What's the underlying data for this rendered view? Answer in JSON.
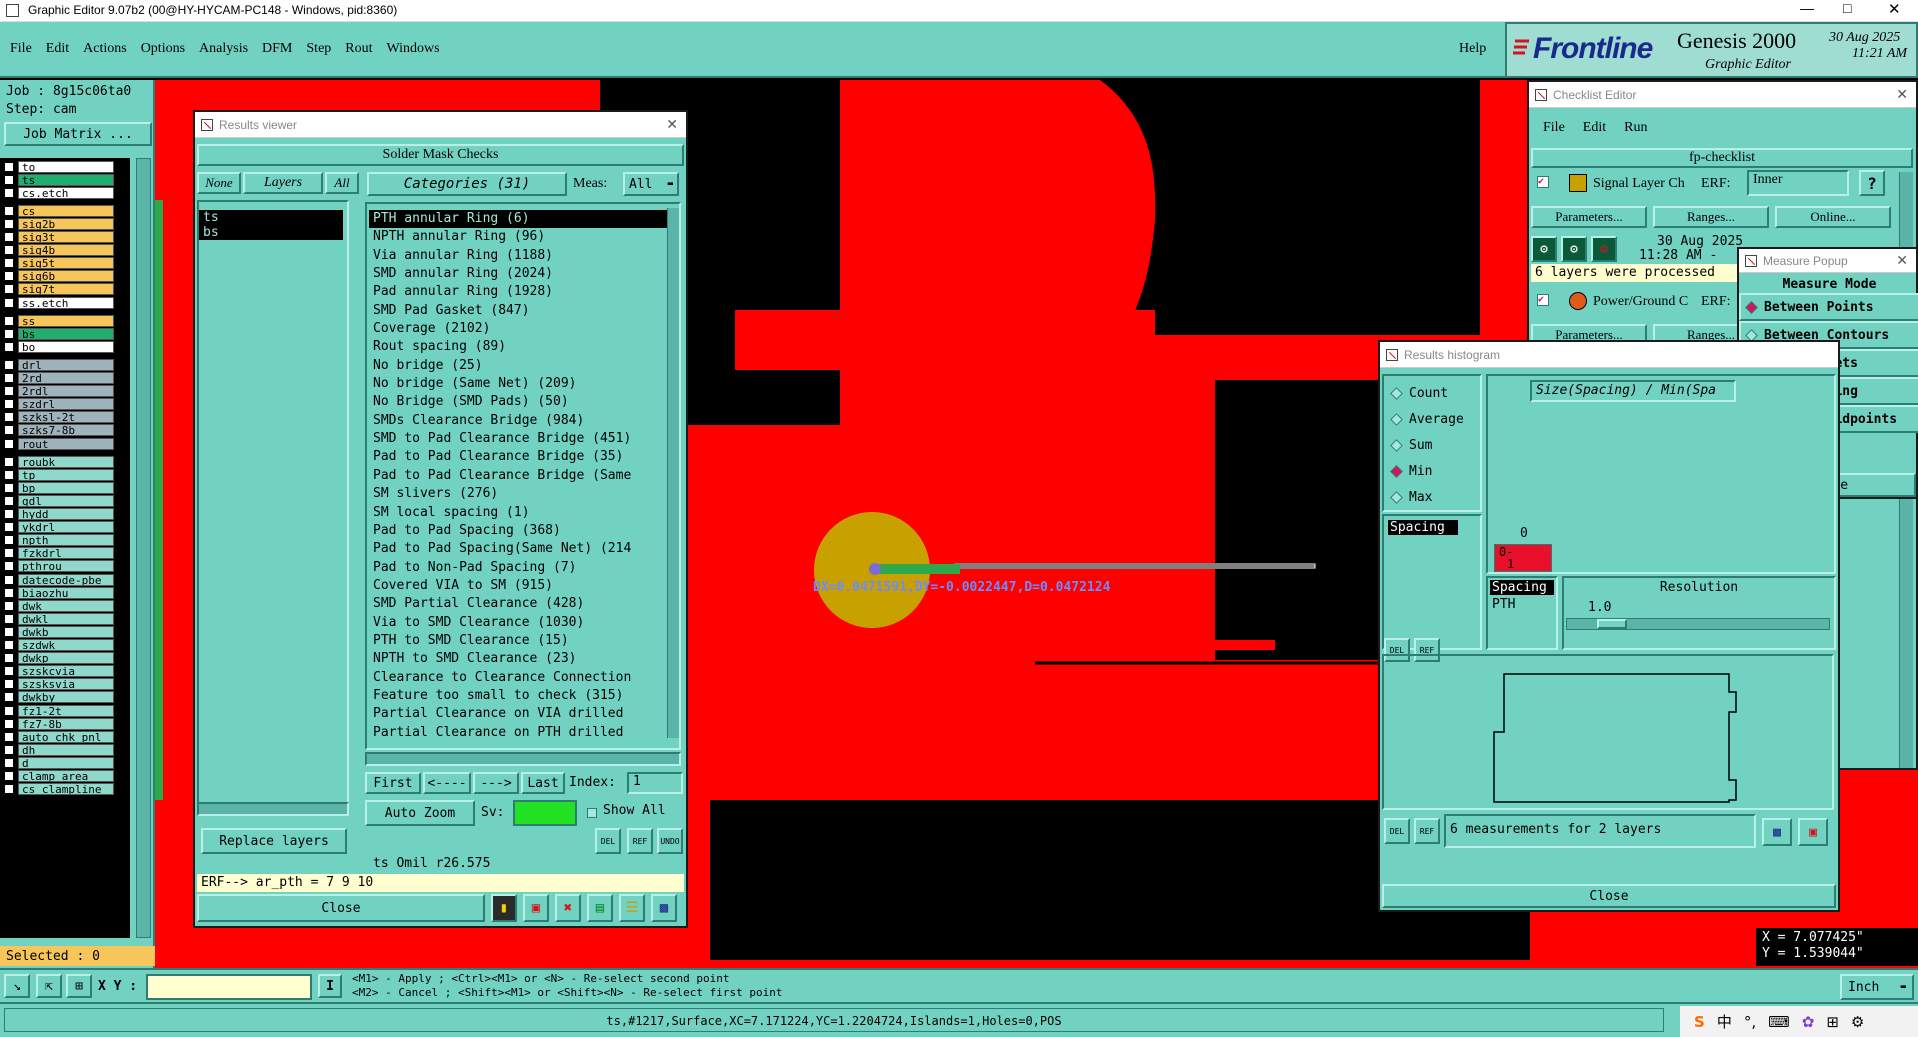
{
  "app_title": "Graphic Editor 9.07b2 (00@HY-HYCAM-PC148 - Windows, pid:8360)",
  "menu": [
    "File",
    "Edit",
    "Actions",
    "Options",
    "Analysis",
    "DFM",
    "Step",
    "Rout",
    "Windows"
  ],
  "help": "Help",
  "brand": {
    "logo": "Frontline",
    "product": "Genesis 2000",
    "sub": "Graphic Editor",
    "date": "30 Aug 2025",
    "time": "11:21 AM"
  },
  "job": {
    "job_label": "Job  : 8g15c06ta0",
    "step_label": "Step: cam",
    "matrix_button": "Job Matrix ..."
  },
  "layers": [
    {
      "name": "to",
      "bg": "#ffffff"
    },
    {
      "name": "ts",
      "bg": "#1fae6e"
    },
    {
      "name": "cs.etch",
      "bg": "#ffffff"
    },
    {
      "name": "cs",
      "bg": "#f7c65a"
    },
    {
      "name": "sig2b",
      "bg": "#f7c65a"
    },
    {
      "name": "sig3t",
      "bg": "#f7c65a"
    },
    {
      "name": "sig4b",
      "bg": "#f7c65a"
    },
    {
      "name": "sig5t",
      "bg": "#f7c65a"
    },
    {
      "name": "sig6b",
      "bg": "#f7c65a"
    },
    {
      "name": "sig7t",
      "bg": "#f7c65a"
    },
    {
      "name": "ss.etch",
      "bg": "#ffffff"
    },
    {
      "name": "ss",
      "bg": "#f7c65a"
    },
    {
      "name": "bs",
      "bg": "#1fae6e"
    },
    {
      "name": "bo",
      "bg": "#ffffff"
    },
    {
      "name": "drl",
      "bg": "#9fb3bd"
    },
    {
      "name": "2rd",
      "bg": "#9fb3bd"
    },
    {
      "name": "2rdl",
      "bg": "#9fb3bd"
    },
    {
      "name": "szdrl",
      "bg": "#9fb3bd"
    },
    {
      "name": "szksl-2t",
      "bg": "#9fb3bd"
    },
    {
      "name": "szks7-8b",
      "bg": "#9fb3bd"
    },
    {
      "name": "rout",
      "bg": "#9fb3bd"
    },
    {
      "name": "roubk",
      "bg": "#8fd8cc"
    },
    {
      "name": "tp",
      "bg": "#8fd8cc"
    },
    {
      "name": "bp",
      "bg": "#8fd8cc"
    },
    {
      "name": "gdl",
      "bg": "#8fd8cc"
    },
    {
      "name": "hydd",
      "bg": "#8fd8cc"
    },
    {
      "name": "ykdrl",
      "bg": "#8fd8cc"
    },
    {
      "name": "npth",
      "bg": "#8fd8cc"
    },
    {
      "name": "fzkdrl",
      "bg": "#8fd8cc"
    },
    {
      "name": "pthrou",
      "bg": "#8fd8cc"
    },
    {
      "name": "datecode-pbe",
      "bg": "#8fd8cc"
    },
    {
      "name": "biaozhu",
      "bg": "#8fd8cc"
    },
    {
      "name": "dwk",
      "bg": "#8fd8cc"
    },
    {
      "name": "dwkl",
      "bg": "#8fd8cc"
    },
    {
      "name": "dwkb",
      "bg": "#8fd8cc"
    },
    {
      "name": "szdwk",
      "bg": "#8fd8cc"
    },
    {
      "name": "dwkp",
      "bg": "#8fd8cc"
    },
    {
      "name": "szskcvia",
      "bg": "#8fd8cc"
    },
    {
      "name": "szsksvia",
      "bg": "#8fd8cc"
    },
    {
      "name": "dwkby",
      "bg": "#8fd8cc"
    },
    {
      "name": "fz1-2t",
      "bg": "#8fd8cc"
    },
    {
      "name": "fz7-8b",
      "bg": "#8fd8cc"
    },
    {
      "name": "auto_chk_pnl",
      "bg": "#8fd8cc"
    },
    {
      "name": "dh",
      "bg": "#8fd8cc"
    },
    {
      "name": "d",
      "bg": "#8fd8cc"
    },
    {
      "name": "clamp_area",
      "bg": "#8fd8cc"
    },
    {
      "name": "cs_clampline",
      "bg": "#8fd8cc"
    }
  ],
  "selected_label": "Selected : 0",
  "results_viewer": {
    "title": "Results viewer",
    "header": "Solder Mask Checks",
    "none_btn": "None",
    "layers_btn": "Layers",
    "all_btn": "All",
    "categories_btn": "Categories (31)",
    "meas_label": "Meas:",
    "meas_value": "All",
    "layer_list": [
      "ts",
      "bs"
    ],
    "categories": [
      "PTH annular Ring (6)",
      "NPTH annular Ring (96)",
      "Via annular Ring (1188)",
      "SMD annular Ring (2024)",
      "Pad annular Ring (1928)",
      "SMD Pad Gasket (847)",
      "Coverage (2102)",
      "Rout spacing (89)",
      "No bridge (25)",
      "No bridge (Same Net) (209)",
      "No Bridge (SMD Pads) (50)",
      "SMDs Clearance Bridge (984)",
      "SMD to Pad Clearance Bridge (451)",
      "Pad to Pad Clearance Bridge (35)",
      "Pad to Pad Clearance Bridge (Same",
      "SM slivers (276)",
      "SM local spacing (1)",
      "Pad to Pad Spacing (368)",
      "Pad to Pad Spacing(Same Net) (214",
      "Pad to Non-Pad Spacing (7)",
      "Covered VIA to SM (915)",
      "SMD Partial Clearance (428)",
      "Via to SMD Clearance (1030)",
      "PTH to SMD Clearance (15)",
      "NPTH to SMD Clearance (23)",
      "Clearance to Clearance Connection",
      "Feature too small to check (315)",
      "Partial Clearance on VIA drilled",
      "Partial Clearance on PTH drilled"
    ],
    "first": "First",
    "prev": "<----",
    "next": "--->",
    "last": "Last",
    "index_label": "Index:",
    "index_value": "1",
    "auto_zoom": "Auto Zoom",
    "sv_label": "Sv:",
    "show_all": "Show All",
    "replace_layers": "Replace layers",
    "del": "DEL",
    "ref": "REF",
    "undo": "UNDO",
    "info_line": "ts Omil  r26.575",
    "erf_line": "ERF--> ar_pth = 7 9 10",
    "close": "Close"
  },
  "checklist": {
    "title": "Checklist Editor",
    "menu": [
      "File",
      "Edit",
      "Run"
    ],
    "name": "fp-checklist",
    "item1": "Signal Layer Ch",
    "erf": "ERF:",
    "erf_value": "Inner",
    "parameters": "Parameters...",
    "ranges": "Ranges...",
    "online": "Online...",
    "date": "30 Aug 2025",
    "time": "11:28 AM -",
    "status": "6 layers were processed",
    "item2": "Power/Ground C",
    "erf2": "ERF:"
  },
  "measure_popup": {
    "title": "Measure Popup",
    "mode_label": "Measure Mode",
    "options": [
      "Between Points",
      "Between Contours",
      "Between Nets",
      "Annular Ring",
      "Between Midpoints"
    ],
    "selected": "Between Points",
    "close": "Close"
  },
  "histogram": {
    "title": "Results histogram",
    "options": [
      "Count",
      "Average",
      "Sum",
      "Min",
      "Max"
    ],
    "selected": "Min",
    "axis_label": "Size(Spacing) / Min(Spa",
    "list_header": "Spacing",
    "zero": "0",
    "bar_label_top": "0-",
    "bar_label_bottom": "1",
    "spacing_header": "Spacing",
    "spacing_value": "PTH",
    "resolution_label": "Resolution",
    "resolution_value": "1.0",
    "measurements": "6 measurements for 2 layers",
    "close": "Close"
  },
  "canvas": {
    "measure_text": "DX=0.0471591,DY=-0.0022447,D=0.0472124"
  },
  "coords": {
    "x": "X = 7.077425\"",
    "y": "Y = 1.539044\""
  },
  "bottom": {
    "xy_label": "X Y :",
    "hint1": "<M1> - Apply  ; <Ctrl><M1> or <N> - Re-select second point",
    "hint2": "<M2> - Cancel ; <Shift><M1> or <Shift><N> - Re-select first point",
    "units": "Inch",
    "status": "ts,#1217,Surface,XC=7.171224,YC=1.2204724,Islands=1,Holes=0,POS"
  },
  "tray": {
    "ime": "中",
    "punct": "°,"
  }
}
